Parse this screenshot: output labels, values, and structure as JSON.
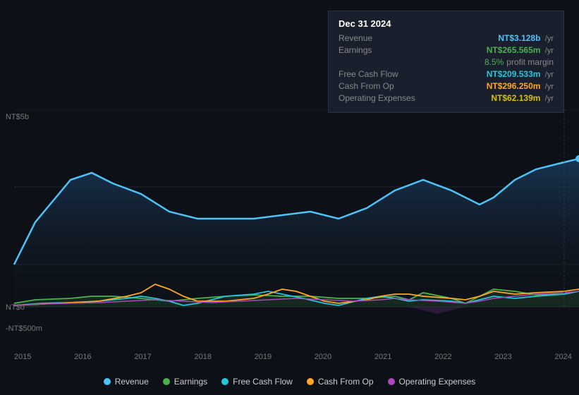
{
  "tooltip": {
    "date": "Dec 31 2024",
    "rows": [
      {
        "label": "Revenue",
        "value": "NT$3.128b",
        "unit": "/yr",
        "colorClass": "blue"
      },
      {
        "label": "Earnings",
        "value": "NT$265.565m",
        "unit": "/yr",
        "colorClass": "green"
      },
      {
        "label": "profit_margin",
        "value": "8.5%",
        "suffix": "profit margin",
        "colorClass": "green"
      },
      {
        "label": "Free Cash Flow",
        "value": "NT$209.533m",
        "unit": "/yr",
        "colorClass": "teal"
      },
      {
        "label": "Cash From Op",
        "value": "NT$296.250m",
        "unit": "/yr",
        "colorClass": "orange"
      },
      {
        "label": "Operating Expenses",
        "value": "NT$62.139m",
        "unit": "/yr",
        "colorClass": "yellow"
      }
    ]
  },
  "yAxis": {
    "top": "NT$5b",
    "mid": "NT$0",
    "bottom": "-NT$500m"
  },
  "xAxis": {
    "labels": [
      "2015",
      "2016",
      "2017",
      "2018",
      "2019",
      "2020",
      "2021",
      "2022",
      "2023",
      "2024"
    ]
  },
  "legend": [
    {
      "label": "Revenue",
      "color": "#4fc3f7"
    },
    {
      "label": "Earnings",
      "color": "#4caf50"
    },
    {
      "label": "Free Cash Flow",
      "color": "#26c6da"
    },
    {
      "label": "Cash From Op",
      "color": "#ffa726"
    },
    {
      "label": "Operating Expenses",
      "color": "#ab47bc"
    }
  ],
  "colors": {
    "blue": "#4fc3f7",
    "green": "#4caf50",
    "teal": "#26c6da",
    "orange": "#ffa726",
    "yellow": "#d4c000",
    "purple": "#ab47bc"
  }
}
